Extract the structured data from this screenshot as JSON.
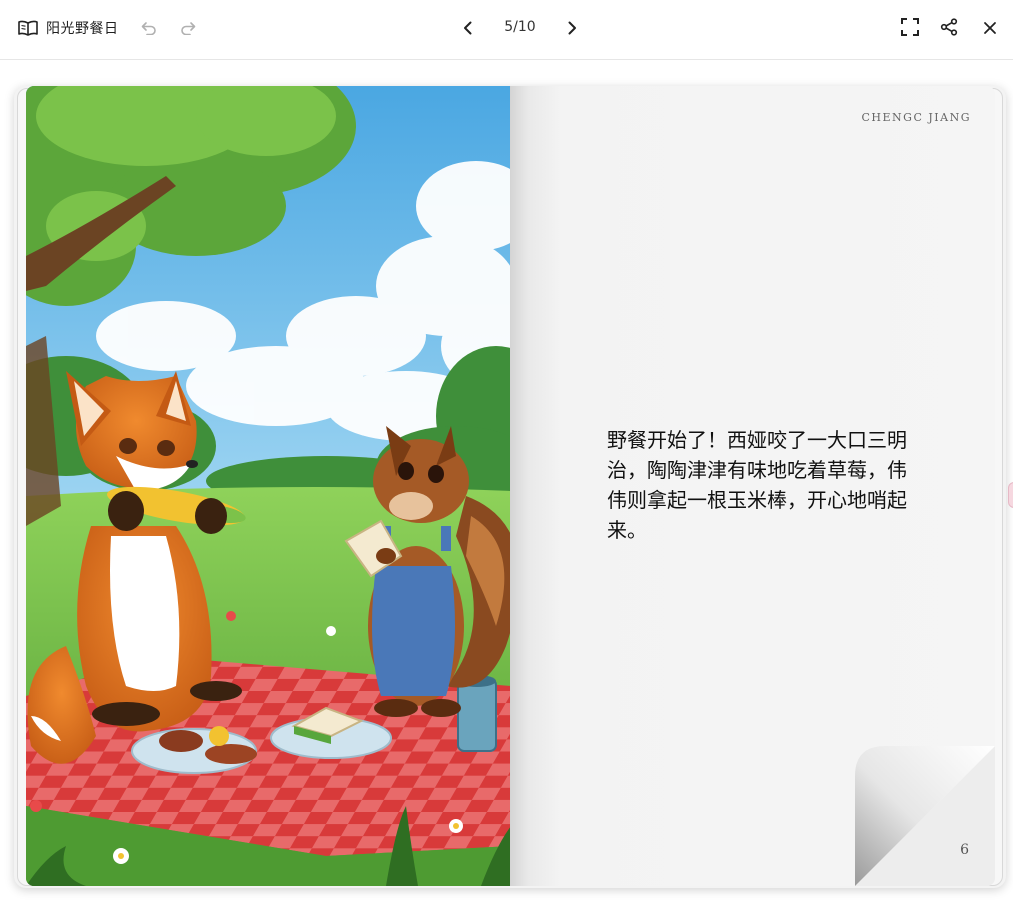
{
  "header": {
    "title": "阳光野餐日",
    "page_counter": "5/10"
  },
  "icons": {
    "book": "book-open-icon",
    "undo": "undo-icon",
    "redo": "redo-icon",
    "prev": "chevron-left-icon",
    "next": "chevron-right-icon",
    "fullscreen": "fullscreen-icon",
    "share": "share-icon",
    "close": "close-icon"
  },
  "book": {
    "illustration": "fox-and-squirrel-picnic-illustration",
    "author": "CHENGC JIANG",
    "text": "野餐开始了！西娅咬了一大口三明治，陶陶津津有味地吃着草莓，伟伟则拿起一根玉米棒，开心地哨起来。",
    "page_number": "6"
  },
  "colors": {
    "blanket_red": "#d83a3a",
    "grass": "#6cb844",
    "sky": "#7cc3ec"
  }
}
